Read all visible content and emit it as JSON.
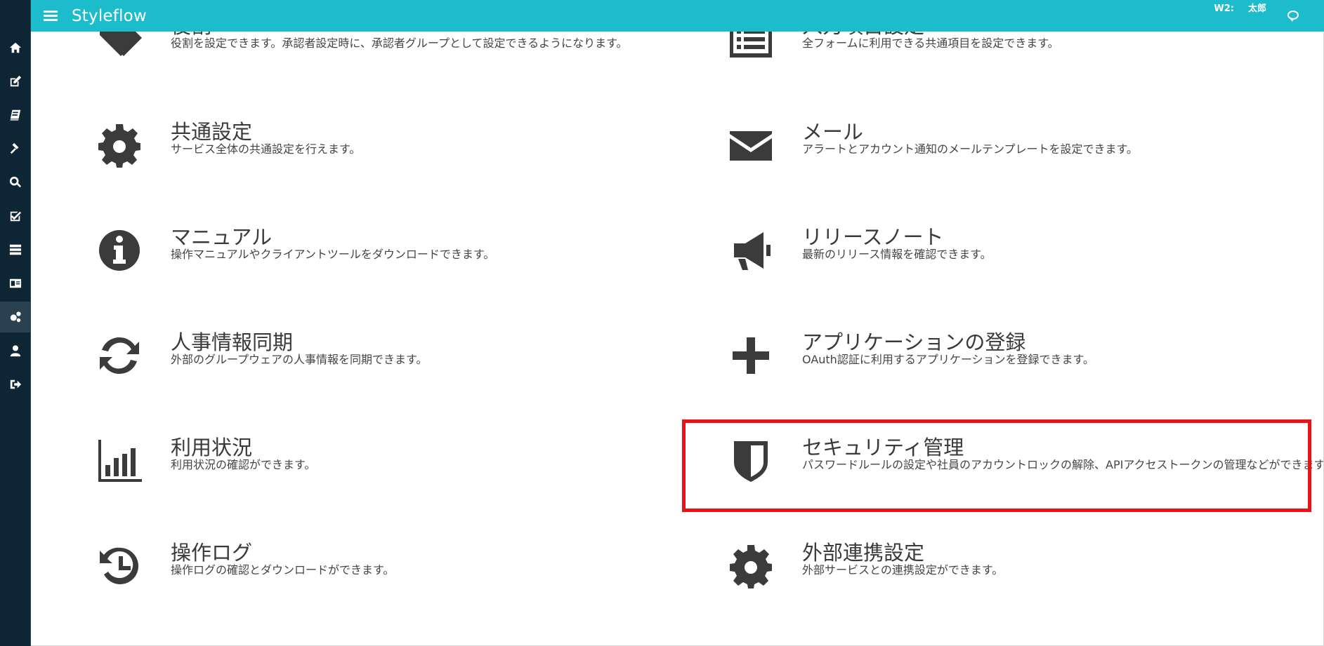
{
  "app": {
    "title": "Styleflow"
  },
  "header": {
    "user_label_1": "W2:",
    "user_label_2": "太郎",
    "chat_icon": "chat-bubble-icon"
  },
  "sidebar": {
    "items": [
      {
        "icon": "home-icon"
      },
      {
        "icon": "edit-icon"
      },
      {
        "icon": "book-icon"
      },
      {
        "icon": "gavel-icon"
      },
      {
        "icon": "search-icon"
      },
      {
        "icon": "check-square-icon"
      },
      {
        "icon": "server-icon"
      },
      {
        "icon": "id-card-icon"
      },
      {
        "icon": "cogs-icon",
        "active": true
      },
      {
        "icon": "user-icon"
      },
      {
        "icon": "sign-out-icon"
      }
    ]
  },
  "tiles": [
    {
      "icon": "tag-icon",
      "title": "役割",
      "desc": "役割を設定できます。承認者設定時に、承認者グループとして設定できるようになります。"
    },
    {
      "icon": "list-icon",
      "title": "入力項目設定",
      "desc": "全フォームに利用できる共通項目を設定できます。"
    },
    {
      "icon": "gear-icon",
      "title": "共通設定",
      "desc": "サービス全体の共通設定を行えます。"
    },
    {
      "icon": "envelope-icon",
      "title": "メール",
      "desc": "アラートとアカウント通知のメールテンプレートを設定できます。"
    },
    {
      "icon": "info-icon",
      "title": "マニュアル",
      "desc": "操作マニュアルやクライアントツールをダウンロードできます。"
    },
    {
      "icon": "bullhorn-icon",
      "title": "リリースノート",
      "desc": "最新のリリース情報を確認できます。"
    },
    {
      "icon": "refresh-icon",
      "title": "人事情報同期",
      "desc": "外部のグループウェアの人事情報を同期できます。"
    },
    {
      "icon": "plus-icon",
      "title": "アプリケーションの登録",
      "desc": "OAuth認証に利用するアプリケーションを登録できます。"
    },
    {
      "icon": "bar-chart-icon",
      "title": "利用状況",
      "desc": "利用状況の確認ができます。"
    },
    {
      "icon": "shield-icon",
      "title": "セキュリティ管理",
      "desc": "パスワードルールの設定や社員のアカウントロックの解除、APIアクセストークンの管理などができます。"
    },
    {
      "icon": "history-icon",
      "title": "操作ログ",
      "desc": "操作ログの確認とダウンロードができます。"
    },
    {
      "icon": "gear-icon",
      "title": "外部連携設定",
      "desc": "外部サービスとの連携設定ができます。"
    }
  ],
  "colors": {
    "header": "#1dbccc",
    "sidebar": "#0e2535",
    "highlight": "#e5141b",
    "icon": "#3b3b3b"
  }
}
